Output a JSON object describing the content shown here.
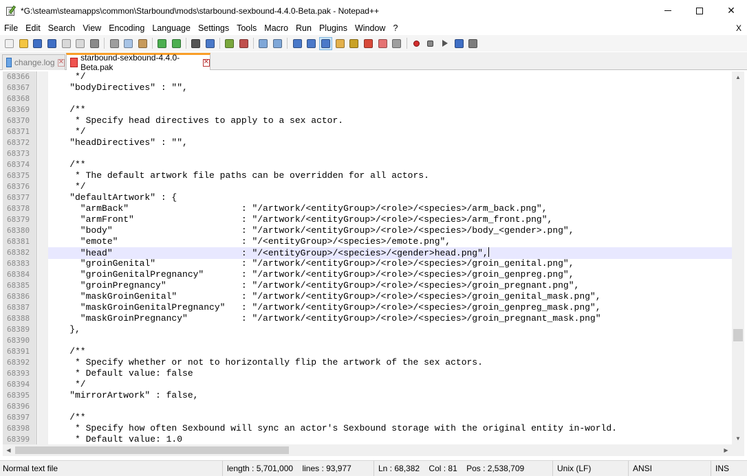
{
  "window": {
    "title": "*G:\\steam\\steamapps\\common\\Starbound\\mods\\starbound-sexbound-4.4.0-Beta.pak - Notepad++",
    "min_icon": "minimize-icon",
    "max_icon": "maximize-icon",
    "close_icon": "close-icon",
    "close_glyph": "✕"
  },
  "menu": {
    "items": [
      "File",
      "Edit",
      "Search",
      "View",
      "Encoding",
      "Language",
      "Settings",
      "Tools",
      "Macro",
      "Run",
      "Plugins",
      "Window",
      "?"
    ],
    "close_doc": "X"
  },
  "toolbar": {
    "buttons": [
      {
        "icon": "new-file-icon",
        "color": "#f0f0f0"
      },
      {
        "icon": "open-file-icon",
        "color": "#f4c542"
      },
      {
        "icon": "save-icon",
        "color": "#3f6fc5"
      },
      {
        "icon": "save-all-icon",
        "color": "#3f6fc5"
      },
      {
        "icon": "close-file-icon",
        "color": "#d9d9d9"
      },
      {
        "icon": "close-all-icon",
        "color": "#d9d9d9"
      },
      {
        "icon": "print-icon",
        "color": "#8a8a8a"
      },
      {
        "icon": "cut-icon",
        "color": "#9e9e9e"
      },
      {
        "icon": "copy-icon",
        "color": "#a8c4e6"
      },
      {
        "icon": "paste-icon",
        "color": "#c79a5b"
      },
      {
        "icon": "undo-icon",
        "color": "#4caf50"
      },
      {
        "icon": "redo-icon",
        "color": "#4caf50"
      },
      {
        "icon": "find-icon",
        "color": "#555555"
      },
      {
        "icon": "replace-icon",
        "color": "#4a79c9"
      },
      {
        "icon": "zoom-in-icon",
        "color": "#7aa83d"
      },
      {
        "icon": "zoom-out-icon",
        "color": "#c0504d"
      },
      {
        "icon": "sync-vertical-icon",
        "color": "#7fa7d8"
      },
      {
        "icon": "sync-horizontal-icon",
        "color": "#7fa7d8"
      },
      {
        "icon": "word-wrap-icon",
        "color": "#4a79c9"
      },
      {
        "icon": "show-all-chars-icon",
        "color": "#4a79c9"
      },
      {
        "icon": "indent-guide-icon",
        "color": "#4a79c9",
        "active": true
      },
      {
        "icon": "document-map-icon",
        "color": "#e3b04b"
      },
      {
        "icon": "function-list-icon",
        "color": "#c9a227"
      },
      {
        "icon": "folder-workspace-icon",
        "color": "#d84a3a"
      },
      {
        "icon": "monitoring-icon",
        "color": "#e57373"
      },
      {
        "icon": "view-icon",
        "color": "#9e9e9e"
      },
      {
        "icon": "record-macro-icon",
        "kind": "rec"
      },
      {
        "icon": "stop-macro-icon",
        "kind": "stop"
      },
      {
        "icon": "play-macro-icon",
        "kind": "play"
      },
      {
        "icon": "run-macro-multiple-icon",
        "color": "#3f6fc5"
      },
      {
        "icon": "save-macro-icon",
        "color": "#7d7d7d"
      }
    ]
  },
  "tabs": [
    {
      "label": "change.log",
      "close": "✕"
    },
    {
      "label": "starbound-sexbound-4.4.0-Beta.pak",
      "close": "✕"
    }
  ],
  "editor": {
    "current_line": "68382",
    "lines": [
      {
        "n": "68366",
        "t": "     */"
      },
      {
        "n": "68367",
        "t": "    \"bodyDirectives\" : \"\","
      },
      {
        "n": "68368",
        "t": ""
      },
      {
        "n": "68369",
        "t": "    /**"
      },
      {
        "n": "68370",
        "t": "     * Specify head directives to apply to a sex actor."
      },
      {
        "n": "68371",
        "t": "     */"
      },
      {
        "n": "68372",
        "t": "    \"headDirectives\" : \"\","
      },
      {
        "n": "68373",
        "t": ""
      },
      {
        "n": "68374",
        "t": "    /**"
      },
      {
        "n": "68375",
        "t": "     * The default artwork file paths can be overridden for all actors."
      },
      {
        "n": "68376",
        "t": "     */"
      },
      {
        "n": "68377",
        "t": "    \"defaultArtwork\" : {"
      },
      {
        "n": "68378",
        "t": "      \"armBack\"                     : \"/artwork/<entityGroup>/<role>/<species>/arm_back.png\","
      },
      {
        "n": "68379",
        "t": "      \"armFront\"                    : \"/artwork/<entityGroup>/<role>/<species>/arm_front.png\","
      },
      {
        "n": "68380",
        "t": "      \"body\"                        : \"/artwork/<entityGroup>/<role>/<species>/body_<gender>.png\","
      },
      {
        "n": "68381",
        "t": "      \"emote\"                       : \"/<entityGroup>/<species>/emote.png\","
      },
      {
        "n": "68382",
        "t": "      \"head\"                        : \"/<entityGroup>/<species>/<gender>head.png\","
      },
      {
        "n": "68383",
        "t": "      \"groinGenital\"                : \"/artwork/<entityGroup>/<role>/<species>/groin_genital.png\","
      },
      {
        "n": "68384",
        "t": "      \"groinGenitalPregnancy\"       : \"/artwork/<entityGroup>/<role>/<species>/groin_genpreg.png\","
      },
      {
        "n": "68385",
        "t": "      \"groinPregnancy\"              : \"/artwork/<entityGroup>/<role>/<species>/groin_pregnant.png\","
      },
      {
        "n": "68386",
        "t": "      \"maskGroinGenital\"            : \"/artwork/<entityGroup>/<role>/<species>/groin_genital_mask.png\","
      },
      {
        "n": "68387",
        "t": "      \"maskGroinGenitalPregnancy\"   : \"/artwork/<entityGroup>/<role>/<species>/groin_genpreg_mask.png\","
      },
      {
        "n": "68388",
        "t": "      \"maskGroinPregnancy\"          : \"/artwork/<entityGroup>/<role>/<species>/groin_pregnant_mask.png\""
      },
      {
        "n": "68389",
        "t": "    },"
      },
      {
        "n": "68390",
        "t": ""
      },
      {
        "n": "68391",
        "t": "    /**"
      },
      {
        "n": "68392",
        "t": "     * Specify whether or not to horizontally flip the artwork of the sex actors."
      },
      {
        "n": "68393",
        "t": "     * Default value: false"
      },
      {
        "n": "68394",
        "t": "     */"
      },
      {
        "n": "68395",
        "t": "    \"mirrorArtwork\" : false,"
      },
      {
        "n": "68396",
        "t": ""
      },
      {
        "n": "68397",
        "t": "    /**"
      },
      {
        "n": "68398",
        "t": "     * Specify how often Sexbound will sync an actor's Sexbound storage with the original entity in-world."
      },
      {
        "n": "68399",
        "t": "     * Default value: 1.0"
      }
    ]
  },
  "scroll": {
    "up": "▲",
    "down": "▼",
    "left": "◀",
    "right": "▶"
  },
  "status": {
    "file_type": "Normal text file",
    "length": "length : 5,701,000",
    "lines": "lines : 93,977",
    "ln": "Ln : 68,382",
    "col": "Col : 81",
    "pos": "Pos : 2,538,709",
    "eol": "Unix (LF)",
    "encoding": "ANSI",
    "mode": "INS"
  }
}
